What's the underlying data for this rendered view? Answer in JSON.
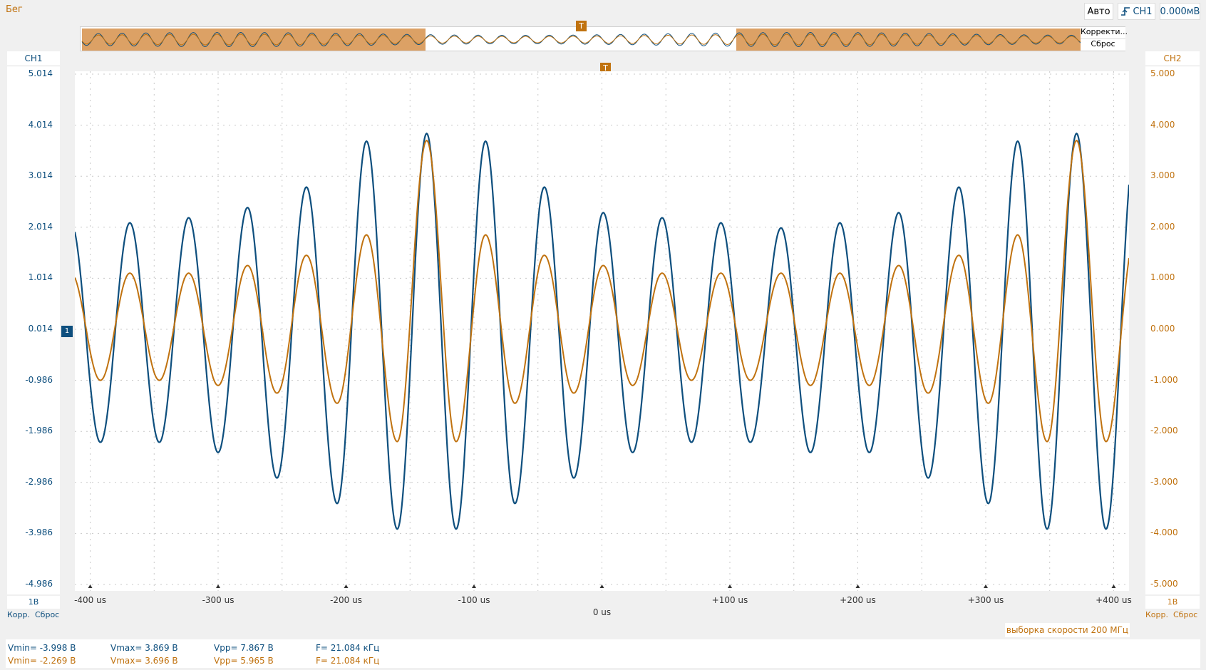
{
  "status": {
    "run_label": "Бег"
  },
  "top_right": {
    "mode": "Авто",
    "trigger_source": "CH1",
    "trigger_level": "0.000мВ"
  },
  "overview": {
    "correct_label": "Корректи...",
    "reset_label": "Сброс",
    "trigger_marker": "T"
  },
  "trigger_marker": "T",
  "channels": {
    "ch1": {
      "name": "CH1",
      "color": "#0e4f7e",
      "scale": "1В",
      "correct": "Корр.",
      "reset": "Сброс",
      "ticks": [
        "5.014",
        "4.014",
        "3.014",
        "2.014",
        "1.014",
        "0.014",
        "-0.986",
        "-1.986",
        "-2.986",
        "-3.986",
        "-4.986"
      ],
      "ground_marker": "1"
    },
    "ch2": {
      "name": "CH2",
      "color": "#c0720f",
      "scale": "1В",
      "correct": "Корр.",
      "reset": "Сброс",
      "ticks": [
        "5.000",
        "4.000",
        "3.000",
        "2.000",
        "1.000",
        "0.000",
        "-1.000",
        "-2.000",
        "-3.000",
        "-4.000",
        "-5.000"
      ]
    }
  },
  "time_axis": {
    "labels": [
      "-400 us",
      "-300 us",
      "-200 us",
      "-100 us",
      "0 us",
      "+100 us",
      "+200 us",
      "+300 us",
      "+400 us"
    ]
  },
  "sample_rate": "выборка скорости 200 МГц",
  "measurements": {
    "ch1": {
      "vmin": "Vmin= -3.998 В",
      "vmax": "Vmax= 3.869 В",
      "vpp": "Vpp= 7.867 В",
      "freq": "F= 21.084 кГц"
    },
    "ch2": {
      "vmin": "Vmin= -2.269 В",
      "vmax": "Vmax= 3.696 В",
      "vpp": "Vpp= 5.965 В",
      "freq": "F= 21.084 кГц"
    }
  },
  "chart_data": {
    "type": "line",
    "xlabel": "",
    "xlim_us": [
      -412,
      412
    ],
    "ylim_ch1": [
      -4.986,
      5.014
    ],
    "ylim_ch2": [
      -5,
      5
    ],
    "frequency_khz": 21.084,
    "series": [
      {
        "name": "CH1",
        "peak_times_us": [
          -369,
          -323,
          -277,
          -231,
          -184,
          -137,
          -91,
          -45,
          1,
          47,
          93,
          140,
          186,
          232,
          279,
          325,
          371,
          417
        ],
        "peak_values": [
          2.1,
          2.2,
          2.4,
          2.8,
          3.7,
          3.85,
          3.7,
          2.8,
          2.3,
          2.2,
          2.1,
          2.0,
          2.1,
          2.3,
          2.8,
          3.7,
          3.85,
          3.7
        ],
        "trough_times_us": [
          -392,
          -346,
          -300,
          -254,
          -207,
          -160,
          -114,
          -68,
          -22,
          24,
          70,
          116,
          163,
          209,
          255,
          302,
          348,
          394
        ],
        "trough_values": [
          -2.2,
          -2.2,
          -2.4,
          -2.9,
          -3.4,
          -3.9,
          -3.9,
          -3.4,
          -2.9,
          -2.4,
          -2.2,
          -2.2,
          -2.4,
          -2.4,
          -2.9,
          -3.4,
          -3.9,
          -3.9
        ]
      },
      {
        "name": "CH2",
        "peak_times_us": [
          -369,
          -323,
          -277,
          -231,
          -184,
          -137,
          -91,
          -45,
          1,
          47,
          93,
          140,
          186,
          232,
          279,
          325,
          371,
          417
        ],
        "peak_values": [
          1.1,
          1.1,
          1.25,
          1.45,
          1.85,
          3.7,
          1.85,
          1.45,
          1.25,
          1.1,
          1.1,
          1.1,
          1.1,
          1.25,
          1.45,
          1.85,
          3.7,
          1.85
        ],
        "trough_times_us": [
          -392,
          -346,
          -300,
          -254,
          -207,
          -160,
          -114,
          -68,
          -22,
          24,
          70,
          116,
          163,
          209,
          255,
          302,
          348,
          394
        ],
        "trough_values": [
          -1.0,
          -1.0,
          -1.1,
          -1.25,
          -1.45,
          -2.2,
          -2.2,
          -1.45,
          -1.25,
          -1.1,
          -1.0,
          -1.0,
          -1.1,
          -1.1,
          -1.25,
          -1.45,
          -2.2,
          -2.2
        ]
      }
    ]
  }
}
